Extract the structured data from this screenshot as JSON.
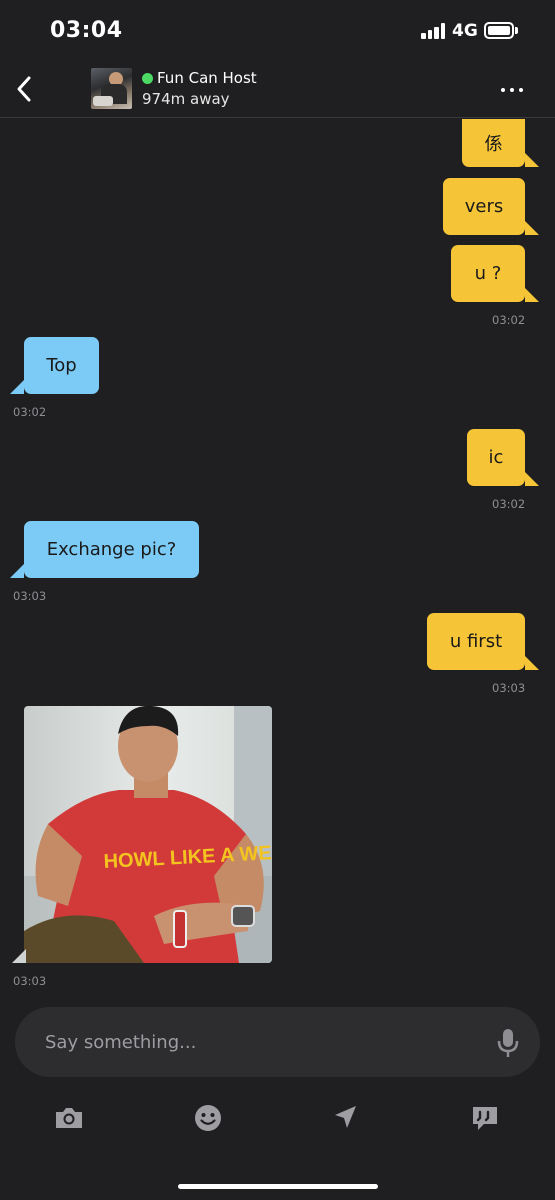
{
  "status_bar": {
    "time": "03:04",
    "network": "4G"
  },
  "header": {
    "contact_name": "Fun Can Host",
    "distance": "974m away",
    "icons": [
      "back-chevron-icon",
      "more-dots-icon"
    ],
    "online_color": "#4cd964"
  },
  "messages": [
    {
      "side": "out",
      "text": "係"
    },
    {
      "side": "out",
      "text": "vers"
    },
    {
      "side": "out",
      "text": "u ?",
      "time": "03:02"
    },
    {
      "side": "in",
      "text": "Top",
      "time": "03:02"
    },
    {
      "side": "out",
      "text": "ic",
      "time": "03:02"
    },
    {
      "side": "in",
      "text": "Exchange pic?",
      "time": "03:03"
    },
    {
      "side": "out",
      "text": "u first",
      "time": "03:03"
    },
    {
      "side": "in",
      "type": "image",
      "shirt_text": "HOWL LIKE A WEREWOLF",
      "time": "03:03"
    }
  ],
  "input": {
    "placeholder": "Say something..."
  },
  "toolbar": {
    "icons": [
      "camera-icon",
      "emoji-icon",
      "location-icon",
      "quick-reply-icon"
    ]
  },
  "colors": {
    "outgoing": "#f5c537",
    "incoming": "#7ccbf6",
    "background": "#1f1f21"
  }
}
